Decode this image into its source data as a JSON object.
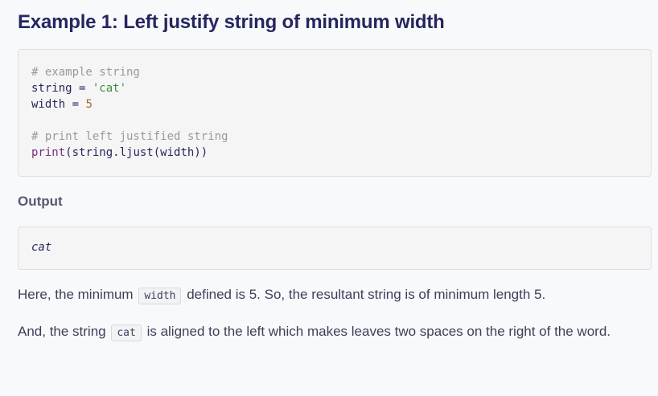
{
  "title": "Example 1: Left justify string of minimum width",
  "code": {
    "line1_comment": "# example string",
    "line2_var": "string",
    "line2_op": " = ",
    "line2_value": "'cat'",
    "line3_var": "width",
    "line3_op": " = ",
    "line3_value": "5",
    "line5_comment": "# print left justified string",
    "line6_fn": "print",
    "line6_rest": "(string.ljust(width))"
  },
  "output": {
    "heading": "Output",
    "text": "cat"
  },
  "paragraph1": {
    "before": "Here, the minimum",
    "code": "width",
    "after": "defined is 5. So, the resultant string is of minimum length 5."
  },
  "paragraph2": {
    "before": "And, the string",
    "code": "cat",
    "after": "is aligned to the left which makes leaves two spaces on the right of the word."
  }
}
